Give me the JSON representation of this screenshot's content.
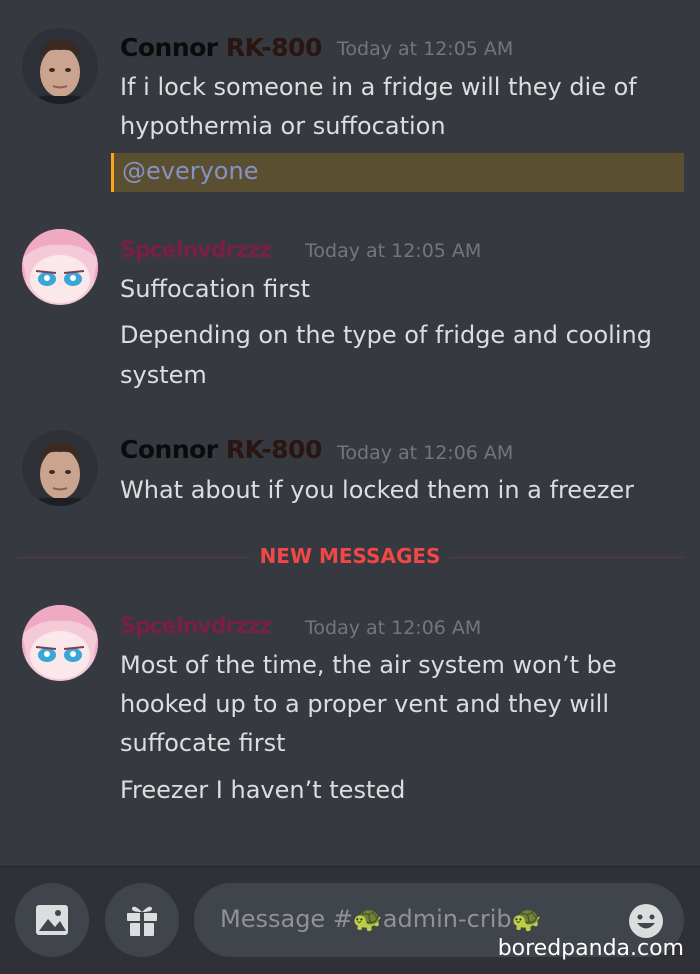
{
  "messages": [
    {
      "author_first": "Connor ",
      "author_second": "RK-800",
      "timestamp": "Today at 12:05 AM",
      "lines": [
        "If i lock someone in a fridge will they die of",
        "hypothermia or suffocation"
      ],
      "mention": "@everyone"
    },
    {
      "author": "SpceInvdrzzz",
      "timestamp": "Today at 12:05 AM",
      "lines": [
        "Suffocation first",
        "Depending on the type of fridge and cooling",
        "system"
      ]
    },
    {
      "author_first": "Connor ",
      "author_second": "RK-800",
      "timestamp": "Today at 12:06 AM",
      "lines": [
        "What about if you locked them in a freezer"
      ]
    },
    {
      "author": "SpceInvdrzzz",
      "timestamp": "Today at 12:06 AM",
      "lines": [
        "Most of the time, the air system won’t be",
        "hooked up to a proper vent and they will",
        "suffocate first",
        "Freezer I haven’t tested"
      ]
    }
  ],
  "divider": {
    "label": "NEW MESSAGES",
    "color": "#f04747"
  },
  "composer": {
    "placeholder": "Message #🐢admin-crib🐢",
    "buttons": [
      "image-icon",
      "gift-icon",
      "emoji-icon"
    ]
  },
  "watermark": "boredpanda.com",
  "colors": {
    "background": "#36393f",
    "mention_bg": "#5a4f30",
    "mention_bar": "#faa61a",
    "timestamp": "#72767d",
    "text": "#dcddde"
  }
}
